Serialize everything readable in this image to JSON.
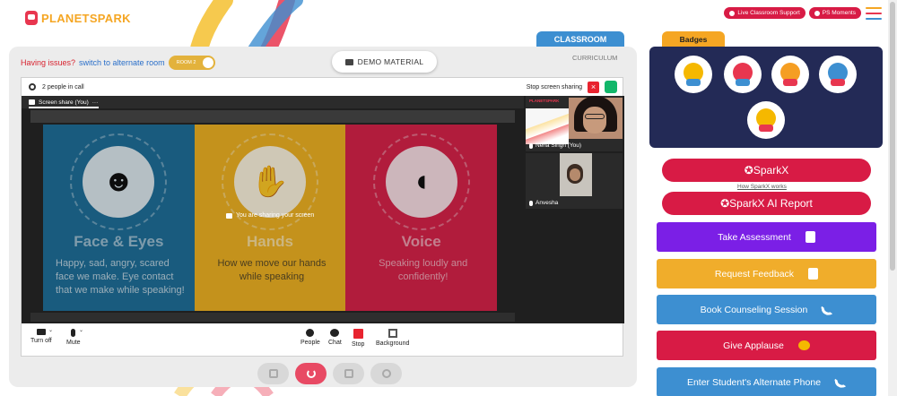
{
  "header": {
    "logo_planet": "PLANET",
    "logo_spark": "SPARK",
    "live_support": "Live Classroom Support",
    "ps_moments": "PS Moments"
  },
  "classroom": {
    "tab_label": "CLASSROOM",
    "curriculum_label": "CURRICULUM",
    "issue_text": "Having issues?",
    "switch_text": "switch to alternate room",
    "room_toggle": "ROOM 2",
    "demo_material": "DEMO MATERIAL"
  },
  "meeting": {
    "people_count": "2 people in call",
    "stop_sharing": "Stop screen sharing",
    "share_tab": "Screen share (You)",
    "sharing_note": "You are sharing your screen",
    "slide": {
      "columns": [
        {
          "title": "Face & Eyes",
          "description": "Happy, sad, angry, scared face we make. Eye contact that we make while speaking!",
          "color": "#1f6f9a"
        },
        {
          "title": "Hands",
          "description": "How we move our hands while speaking",
          "color": "#f0b323"
        },
        {
          "title": "Voice",
          "description": "Speaking loudly and confidently!",
          "color": "#d8234a"
        }
      ]
    },
    "participants": [
      {
        "name": "Neha Singh (You)"
      },
      {
        "name": "Anvesha"
      }
    ],
    "controls": {
      "turn_off": "Turn off",
      "mute": "Mute",
      "people": "People",
      "chat": "Chat",
      "stop": "Stop",
      "background": "Background"
    }
  },
  "badges": {
    "tab_label": "Badges",
    "items": [
      {
        "icon": "trophy-badge-icon"
      },
      {
        "icon": "raised-hands-badge-icon"
      },
      {
        "icon": "meditation-badge-icon"
      },
      {
        "icon": "speaker-badge-icon"
      },
      {
        "icon": "smart-glasses-badge-icon"
      }
    ]
  },
  "sidebar": {
    "sparkx": "SparkX",
    "how_sparkx": "How SparkX works",
    "sparkx_report": "SparkX AI Report",
    "actions": [
      {
        "label": "Take Assessment",
        "color": "#7b1fe6",
        "icon": "clipboard-icon"
      },
      {
        "label": "Request Feedback",
        "color": "#f0ad2b",
        "icon": "document-icon"
      },
      {
        "label": "Book Counseling Session",
        "color": "#3d8fd1",
        "icon": "phone-icon"
      },
      {
        "label": "Give Applause",
        "color": "#d81b45",
        "icon": "clap-icon"
      },
      {
        "label": "Enter Student's Alternate Phone",
        "color": "#3d8fd1",
        "icon": "phone-icon"
      }
    ]
  }
}
